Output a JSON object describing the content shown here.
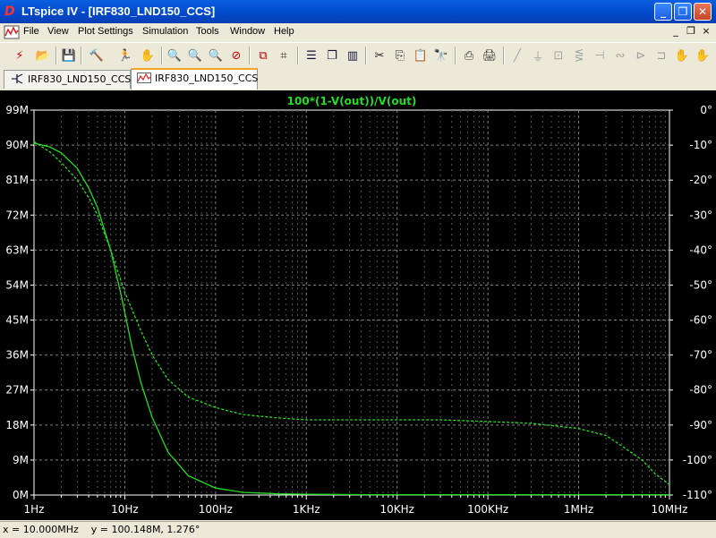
{
  "window": {
    "app_icon": "D",
    "title": "LTspice IV - [IRF830_LND150_CCS]",
    "minimize": "_",
    "maximize": "❐",
    "close": "✕"
  },
  "menu": {
    "items": [
      "File",
      "View",
      "Plot Settings",
      "Simulation",
      "Tools",
      "Window",
      "Help"
    ],
    "mdi_minimize": "_",
    "mdi_restore": "❐",
    "mdi_close": "×"
  },
  "toolbar": {
    "icons": [
      "schematic-icon",
      "open-icon",
      "save-icon",
      "hammer-icon",
      "run-icon",
      "halt-icon",
      "zoom-in-icon",
      "zoom-out-icon",
      "zoom-fit-icon",
      "zoom-cancel-icon",
      "autorange-icon",
      "grid-icon",
      "tile-horizontal-icon",
      "cascade-icon",
      "tile-vertical-icon",
      "cut-icon",
      "copy-icon",
      "find-icon",
      "print-setup-icon",
      "print-icon",
      "wire-icon",
      "ground-icon",
      "label-icon",
      "resistor-icon",
      "capacitor-icon",
      "inductor-icon",
      "diode-icon",
      "component-icon",
      "move-icon",
      "drag-icon"
    ]
  },
  "tabs": [
    {
      "label": "IRF830_LND150_CCS",
      "active": false
    },
    {
      "label": "IRF830_LND150_CCS",
      "active": true
    }
  ],
  "plot": {
    "trace_label": "100*(1-V(out))/V(out)",
    "trace_color": "#22dd22",
    "background": "#000000",
    "grid_color": "#808080"
  },
  "status": {
    "text": "x = 10.000MHz    y = 100.148M, 1.276°"
  },
  "chart_data": {
    "type": "line",
    "x_scale": "log",
    "x_ticks": [
      "1Hz",
      "10Hz",
      "100Hz",
      "1KHz",
      "10KHz",
      "100KHz",
      "1MHz",
      "10MHz"
    ],
    "xlim": [
      1,
      10000000
    ],
    "y_left_ticks": [
      "99M",
      "90M",
      "81M",
      "72M",
      "63M",
      "54M",
      "45M",
      "36M",
      "27M",
      "18M",
      "9M",
      "0M"
    ],
    "ylim_left": [
      0,
      99
    ],
    "y_right_ticks": [
      "0°",
      "-10°",
      "-20°",
      "-30°",
      "-40°",
      "-50°",
      "-60°",
      "-70°",
      "-80°",
      "-90°",
      "-100°",
      "-110°"
    ],
    "ylim_right": [
      -110,
      0
    ],
    "series": [
      {
        "name": "100*(1-V(out))/V(out)",
        "style": "solid",
        "x": [
          1,
          1.5,
          2,
          3,
          4,
          5,
          6,
          7,
          8,
          9,
          10,
          12,
          15,
          20,
          30,
          50,
          100,
          200,
          500,
          1000,
          2000,
          5000,
          10000,
          20000,
          50000,
          100000,
          1000000,
          10000000
        ],
        "y": [
          90.5,
          89.5,
          88,
          84,
          79,
          74,
          68,
          63,
          57,
          52,
          47,
          38,
          29,
          20,
          11,
          5,
          1.8,
          0.7,
          0.3,
          0.2,
          0.15,
          0.1,
          0.1,
          0.1,
          0.1,
          0.1,
          0.1,
          0.1
        ]
      },
      {
        "name": "phase",
        "style": "dashed",
        "x": [
          1,
          1.5,
          2,
          3,
          4,
          5,
          7,
          10,
          15,
          20,
          30,
          50,
          100,
          200,
          500,
          1000,
          3000,
          10000,
          30000,
          100000,
          300000,
          1000000,
          2000000,
          3000000,
          5000000,
          7000000,
          10000000
        ],
        "y": [
          -9,
          -12,
          -15,
          -20,
          -25,
          -30,
          -40,
          -52,
          -63,
          -70,
          -77,
          -82,
          -85,
          -87,
          -88,
          -88.5,
          -88.5,
          -88.5,
          -88.5,
          -89,
          -89.5,
          -91,
          -93,
          -96,
          -100,
          -104,
          -107
        ]
      }
    ]
  }
}
